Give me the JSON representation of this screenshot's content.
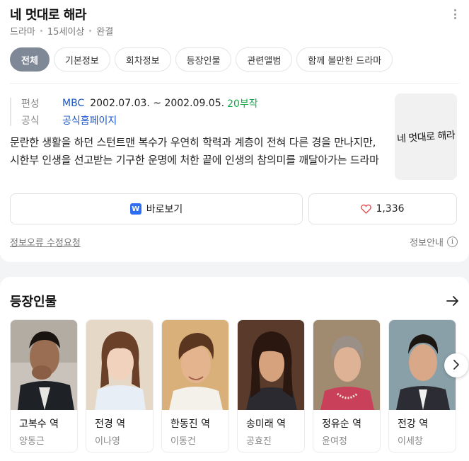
{
  "header": {
    "title": "네 멋대로 해라",
    "meta": [
      "드라마",
      "15세이상",
      "완결"
    ]
  },
  "tabs": [
    {
      "label": "전체",
      "active": true
    },
    {
      "label": "기본정보",
      "active": false
    },
    {
      "label": "회차정보",
      "active": false
    },
    {
      "label": "등장인물",
      "active": false
    },
    {
      "label": "관련앨범",
      "active": false
    },
    {
      "label": "함께 볼만한 드라마",
      "active": false
    }
  ],
  "info": {
    "broadcast_key": "편성",
    "broadcaster": "MBC",
    "period": "2002.07.03. ~ 2002.09.05.",
    "episodes": "20부작",
    "official_key": "공식",
    "official_link": "공식홈페이지"
  },
  "description": "문란한 생활을 하던 스턴트맨 복수가 우연히 학력과 계층이 전혀 다른 경을 만나지만, 시한부 인생을 선고받는 기구한 운명에 처한 끝에 인생의 참의미를 깨달아가는 드라마",
  "poster": {
    "text": "네 멋대로 해라"
  },
  "actions": {
    "watch_label": "바로보기",
    "watch_logo": "W",
    "like_count": "1,336"
  },
  "footer": {
    "report_label": "정보오류 수정요청",
    "notice_label": "정보안내",
    "notice_icon": "i"
  },
  "cast_section": {
    "title": "등장인물",
    "members": [
      {
        "role": "고복수 역",
        "actor": "양동근"
      },
      {
        "role": "전경 역",
        "actor": "이나영"
      },
      {
        "role": "한동진 역",
        "actor": "이동건"
      },
      {
        "role": "송미래 역",
        "actor": "공효진"
      },
      {
        "role": "정유순 역",
        "actor": "윤여정"
      },
      {
        "role": "전강 역",
        "actor": "이세창"
      }
    ]
  },
  "colors": {
    "accent_tab": "#7f8896",
    "link": "#1a56c8",
    "episodes": "#1aa84b",
    "heart": "#e5484d",
    "watch_logo": "#2f6ef3"
  }
}
